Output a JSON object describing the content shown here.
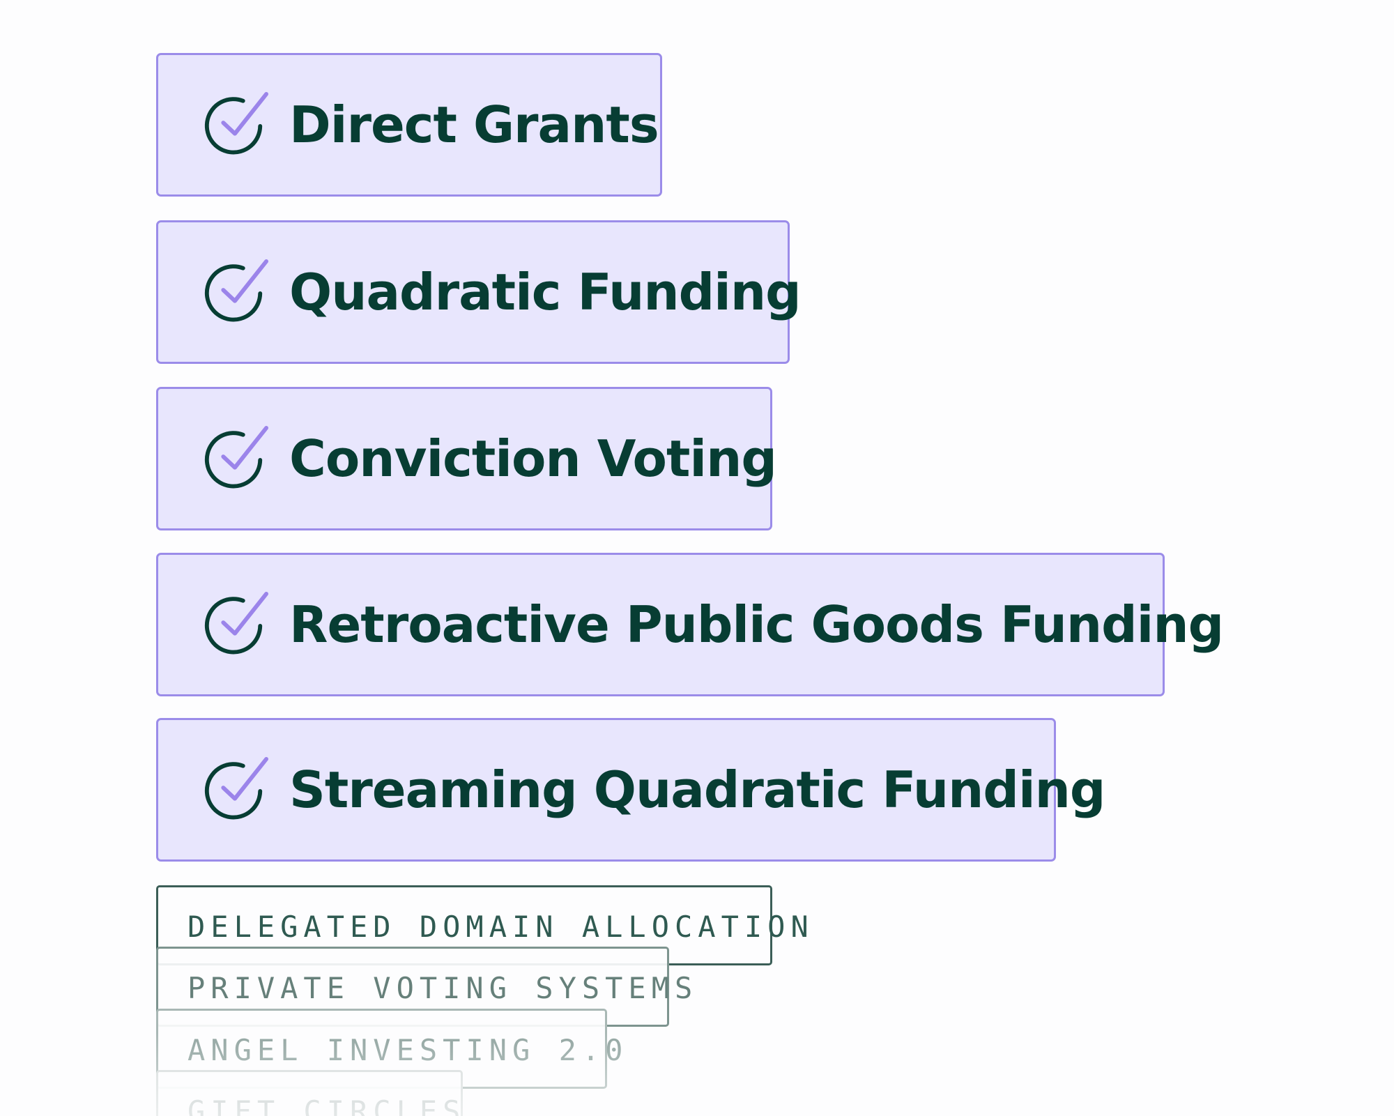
{
  "featured_mechanisms": [
    {
      "label": "Direct Grants",
      "icon": "check-circle-icon"
    },
    {
      "label": "Quadratic Funding",
      "icon": "check-circle-icon"
    },
    {
      "label": "Conviction Voting",
      "icon": "check-circle-icon"
    },
    {
      "label": "Retroactive Public Goods Funding",
      "icon": "check-circle-icon"
    },
    {
      "label": "Streaming Quadratic Funding",
      "icon": "check-circle-icon"
    }
  ],
  "more_mechanisms": [
    {
      "label": "DELEGATED DOMAIN ALLOCATION"
    },
    {
      "label": "PRIVATE VOTING SYSTEMS"
    },
    {
      "label": "ANGEL INVESTING 2.0"
    },
    {
      "label": "GIFT CIRCLES"
    }
  ],
  "colors": {
    "card_background": "#e8e6fd",
    "card_border": "#9b8ce9",
    "text_dark_green": "#073d33",
    "check_mark_purple": "#9b84ea"
  }
}
